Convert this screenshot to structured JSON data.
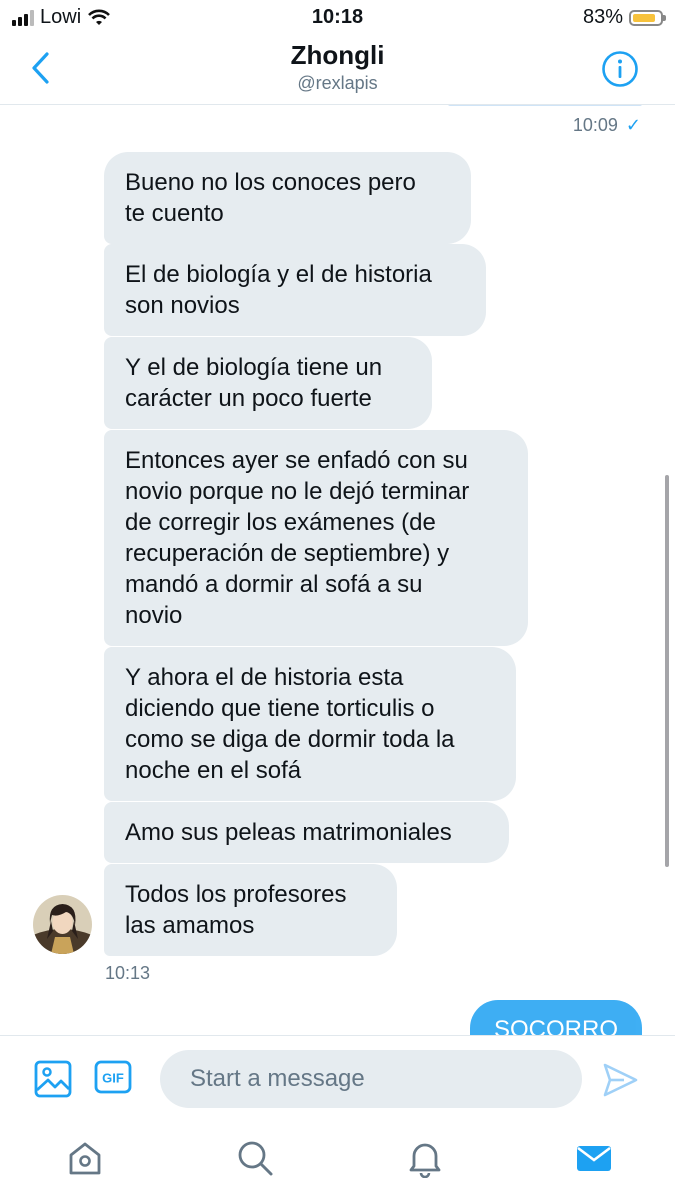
{
  "status_bar": {
    "carrier": "Lowi",
    "time": "10:18",
    "battery_percent": "83%",
    "battery_level": 0.83
  },
  "header": {
    "title": "Zhongli",
    "handle": "@rexlapis"
  },
  "conversation": {
    "last_sent_time": "10:09",
    "messages": [
      {
        "text": "Bueno no los conoces pero\nte cuento"
      },
      {
        "text": "El de biología y el de historia\nson novios"
      },
      {
        "text": "Y el de biología tiene un\ncarácter un poco fuerte"
      },
      {
        "text": "Entonces ayer se enfadó con su\nnovio porque no le dejó terminar\nde corregir los exámenes (de\nrecuperación de septiembre) y\nmandó a dormir al sofá a su\nnovio"
      },
      {
        "text": "Y ahora el de historia esta\ndiciendo que tiene torticulis o\ncomo se diga de dormir toda la\nnoche en el sofá"
      },
      {
        "text": "Amo sus peleas matrimoniales"
      },
      {
        "text": "Todos los profesores\nlas amamos"
      }
    ],
    "received_time": "10:13",
    "sent_partial": "SOCORRO"
  },
  "composer": {
    "placeholder": "Start a message",
    "gif_label": "GIF"
  },
  "colors": {
    "accent": "#1da1f2",
    "bubble_received": "#e6ecf0",
    "muted": "#657786"
  },
  "tabs": [
    {
      "icon": "home-icon"
    },
    {
      "icon": "search-icon"
    },
    {
      "icon": "bell-icon"
    },
    {
      "icon": "mail-icon",
      "active": true
    }
  ]
}
